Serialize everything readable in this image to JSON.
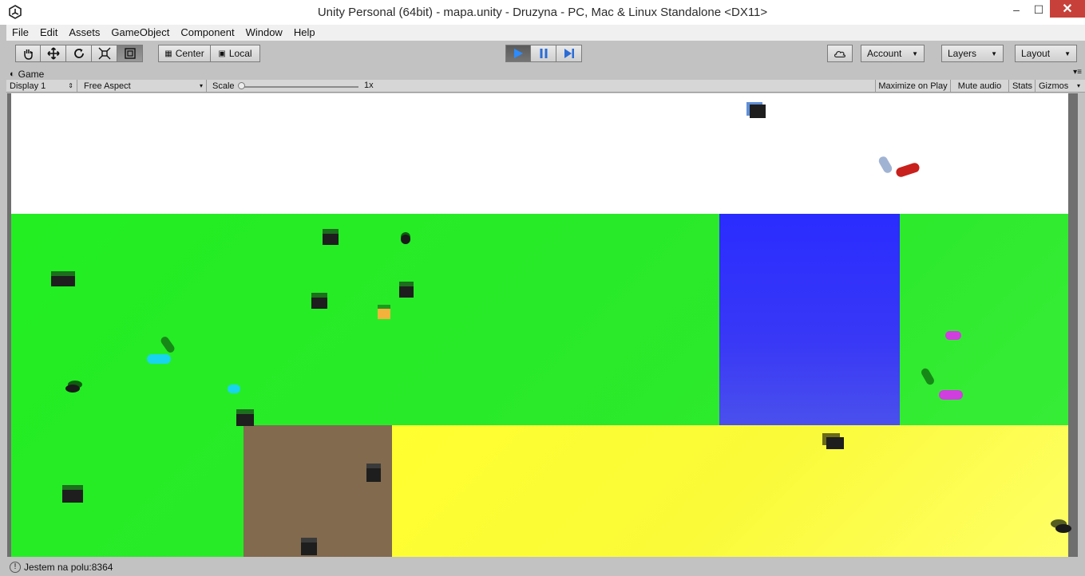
{
  "window": {
    "title": "Unity Personal (64bit) - mapa.unity - Druzyna - PC, Mac & Linux Standalone <DX11>",
    "minimize": "–",
    "maximize": "☐",
    "close": "✕"
  },
  "menu": [
    "File",
    "Edit",
    "Assets",
    "GameObject",
    "Component",
    "Window",
    "Help"
  ],
  "toolbar": {
    "tools": [
      "hand-tool",
      "move-tool",
      "rotate-tool",
      "scale-tool",
      "rect-tool"
    ],
    "pivot_label": "Center",
    "space_label": "Local",
    "account_label": "Account",
    "layers_label": "Layers",
    "layout_label": "Layout"
  },
  "game_panel": {
    "tab_label": "Game",
    "display_label": "Display 1",
    "aspect_label": "Free Aspect",
    "scale_label": "Scale",
    "scale_value": "1x",
    "maximize_label": "Maximize on Play",
    "mute_label": "Mute audio",
    "stats_label": "Stats",
    "gizmos_label": "Gizmos"
  },
  "scene_colors": {
    "sky": "#ffffff",
    "grass": "#22ee22",
    "water": "#2a2cff",
    "dirt": "#826a4f",
    "sand": "#ffff30"
  },
  "status": {
    "message": "Jestem na polu:8364"
  }
}
